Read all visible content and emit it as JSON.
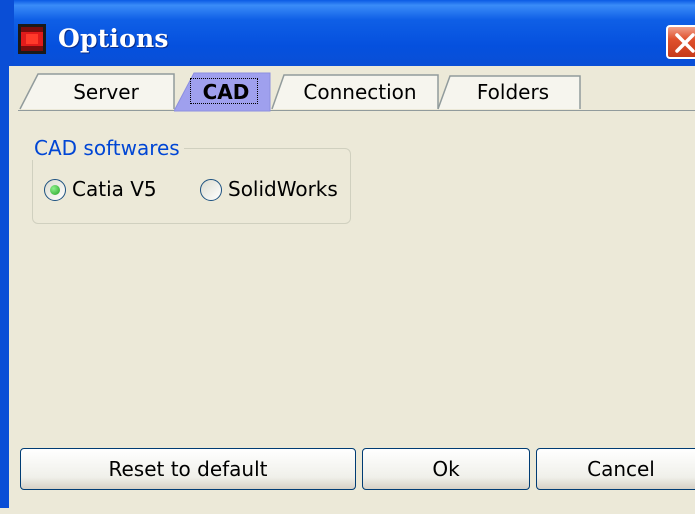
{
  "window": {
    "title": "Options"
  },
  "tabs": [
    {
      "label": "Server",
      "active": false
    },
    {
      "label": "CAD",
      "active": true
    },
    {
      "label": "Connection",
      "active": false
    },
    {
      "label": "Folders",
      "active": false
    }
  ],
  "cad": {
    "group_label": "CAD softwares",
    "options": [
      {
        "label": "Catia V5",
        "selected": true
      },
      {
        "label": "SolidWorks",
        "selected": false
      }
    ]
  },
  "buttons": {
    "reset": "Reset to default",
    "ok": "Ok",
    "cancel": "Cancel"
  },
  "colors": {
    "titlebar": "#0550de",
    "tab_active": "#9fa0ee",
    "group_label": "#0046d5",
    "close_button": "#e0512d"
  }
}
